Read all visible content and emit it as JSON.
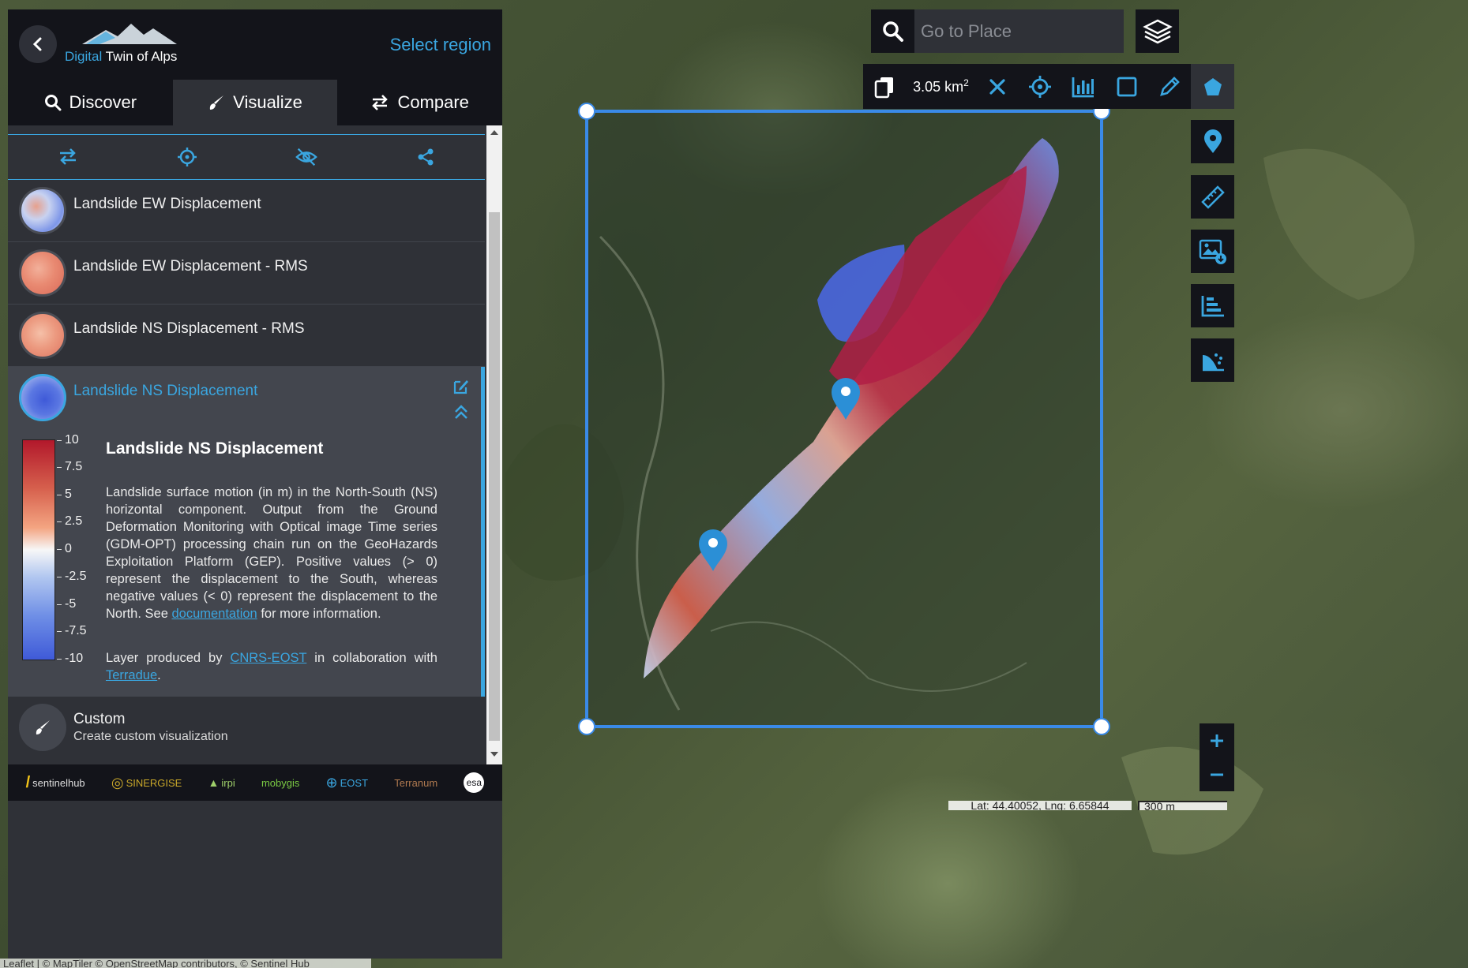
{
  "app": {
    "logo_prefix": "Digital",
    "logo_suffix": "Twin of Alps",
    "select_region": "Select region"
  },
  "tabs": [
    {
      "label": "Discover",
      "icon": "search-icon"
    },
    {
      "label": "Visualize",
      "icon": "brush-icon",
      "active": true
    },
    {
      "label": "Compare",
      "icon": "swap-icon"
    }
  ],
  "layers": [
    {
      "title": "Landslide EW Displacement"
    },
    {
      "title": "Landslide EW Displacement - RMS"
    },
    {
      "title": "Landslide NS Displacement - RMS"
    }
  ],
  "active_layer": {
    "title": "Landslide NS Displacement",
    "legend_ticks": [
      "10",
      "7.5",
      "5",
      "2.5",
      "0",
      "-2.5",
      "-5",
      "-7.5",
      "-10"
    ],
    "legend_colors": [
      "#b2182b",
      "#f7f7f7",
      "#3f5ad8"
    ],
    "description_title": "Landslide NS Displacement",
    "description_main": "Landslide surface motion (in m) in the North-South (NS) horizontal component. Output from the Ground Deformation Monitoring with Optical image Time series (GDM-OPT) processing chain run on the GeoHazards Exploitation Platform (GEP). Positive values (> 0) represent the displacement to the South, whereas negative values (< 0) represent the displacement to the North. See",
    "description_link": "documentation",
    "description_end": "for more information.",
    "credit_prefix": "Layer produced by",
    "credit_link1": "CNRS-EOST",
    "credit_mid": "in collaboration with",
    "credit_link2": "Terradue",
    "credit_end": "."
  },
  "custom": {
    "title": "Custom",
    "subtitle": "Create custom visualization"
  },
  "partners": [
    "sentinelhub",
    "SINERGISE",
    "irpi",
    "mobygis",
    "EOST",
    "Terranum",
    "esa"
  ],
  "attribution": "Leaflet | © MapTiler © OpenStreetMap contributors, © Sentinel Hub",
  "search": {
    "placeholder": "Go to Place"
  },
  "aoi": {
    "area_value": "3.05 km",
    "area_exp": "2"
  },
  "status": {
    "coords": "Lat: 44.40052, Lng: 6.65844",
    "scale": "300 m"
  },
  "colors": {
    "accent": "#3aa6e0",
    "panel_dark": "#13141a",
    "panel": "#2f3137"
  }
}
